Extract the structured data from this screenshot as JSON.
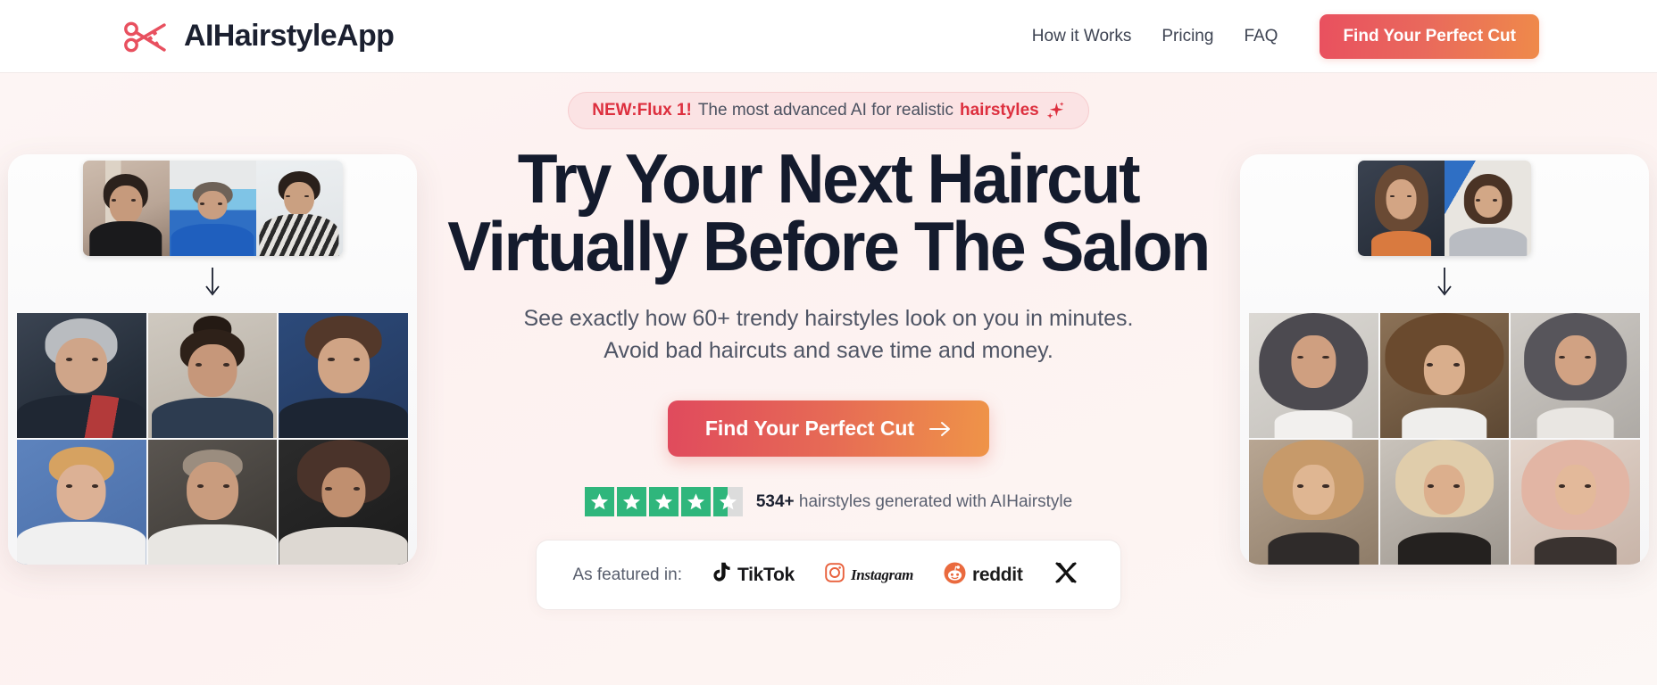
{
  "header": {
    "brand_name": "AIHairstyleApp",
    "logo_icon": "scissors-icon",
    "nav": [
      {
        "label": "How it Works"
      },
      {
        "label": "Pricing"
      },
      {
        "label": "FAQ"
      }
    ],
    "cta_label": "Find Your Perfect Cut"
  },
  "hero": {
    "badge": {
      "prefix": "NEW:Flux 1!",
      "middle": "The most advanced AI for realistic",
      "highlight": "hairstyles",
      "icon": "sparkle-icon"
    },
    "headline_line1": "Try Your Next Haircut",
    "headline_line2": "Virtually Before The Salon",
    "subhead_line1": "See exactly how 60+ trendy hairstyles look on you in minutes.",
    "subhead_line2": "Avoid bad haircuts and save time and money.",
    "cta_label": "Find Your Perfect Cut",
    "cta_icon": "arrow-right-icon"
  },
  "rating": {
    "stars_total": 5,
    "stars_filled": 4,
    "stars_half": 1,
    "star_color": "#2fb67c",
    "star_empty_color": "#dcdcdc",
    "count": "534+",
    "text": "hairstyles generated with AIHairstyle"
  },
  "featured": {
    "label": "As featured in:",
    "logos": [
      {
        "name": "tiktok",
        "text": "TikTok",
        "icon": "tiktok-icon"
      },
      {
        "name": "instagram",
        "text": "Instagram",
        "icon": "instagram-icon"
      },
      {
        "name": "reddit",
        "text": "reddit",
        "icon": "reddit-icon"
      },
      {
        "name": "x",
        "text": "",
        "icon": "x-icon"
      }
    ]
  },
  "colors": {
    "accent_start": "#e04a5d",
    "accent_end": "#ef9448",
    "badge_red": "#dd2f3e",
    "headline": "#141b2d",
    "body_text": "#4f5565",
    "page_bg": "#fdf2f0"
  },
  "left_showcase": {
    "caption": "male hairstyle before and after collage",
    "inputs": [
      {
        "label": "input-photo-1"
      },
      {
        "label": "input-photo-2"
      },
      {
        "label": "input-photo-3"
      }
    ],
    "arrow_icon": "arrow-down-icon",
    "results": [
      {
        "label": "silver-mohawk-style"
      },
      {
        "label": "man-bun-style"
      },
      {
        "label": "curly-medium-style"
      },
      {
        "label": "blonde-quiff-style"
      },
      {
        "label": "buzz-cut-style"
      },
      {
        "label": "long-curly-style"
      }
    ]
  },
  "right_showcase": {
    "caption": "female hairstyle before and after collage",
    "inputs": [
      {
        "label": "input-photo-1"
      },
      {
        "label": "input-photo-2"
      }
    ],
    "arrow_icon": "arrow-down-icon",
    "results": [
      {
        "label": "long-wavy-style"
      },
      {
        "label": "curly-bangs-style"
      },
      {
        "label": "shoulder-wavy-style"
      },
      {
        "label": "blonde-bob-bangs-style"
      },
      {
        "label": "platinum-lob-style"
      },
      {
        "label": "rose-blonde-wavy-style"
      }
    ]
  }
}
